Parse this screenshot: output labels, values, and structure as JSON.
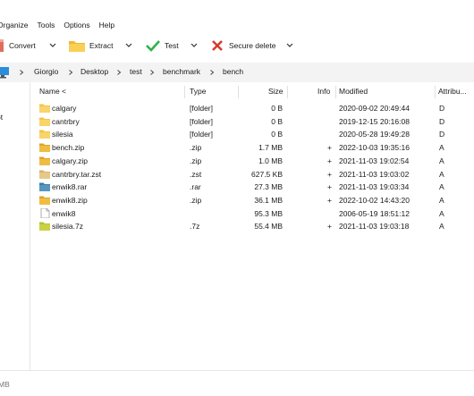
{
  "menu": [
    "Organize",
    "Tools",
    "Options",
    "Help"
  ],
  "toolbar": {
    "convert": "Convert",
    "extract": "Extract",
    "test": "Test",
    "secure_delete": "Secure delete"
  },
  "breadcrumb": [
    "Giorgio",
    "Desktop",
    "test",
    "benchmark",
    "bench"
  ],
  "nav": {
    "partial_label": "pt"
  },
  "columns": {
    "name": "Name <",
    "type": "Type",
    "size": "Size",
    "info": "Info",
    "modified": "Modified",
    "attributes": "Attribu..."
  },
  "files": [
    {
      "name": "calgary",
      "type": "[folder]",
      "size": "0 B",
      "info": "",
      "modified": "2020-09-02 20:49:44",
      "attr": "D",
      "icon": "folder-icon"
    },
    {
      "name": "cantrbry",
      "type": "[folder]",
      "size": "0 B",
      "info": "",
      "modified": "2019-12-15 20:16:08",
      "attr": "D",
      "icon": "folder-icon"
    },
    {
      "name": "silesia",
      "type": "[folder]",
      "size": "0 B",
      "info": "",
      "modified": "2020-05-28 19:49:28",
      "attr": "D",
      "icon": "folder-icon"
    },
    {
      "name": "bench.zip",
      "type": ".zip",
      "size": "1.7 MB",
      "info": "+",
      "modified": "2022-10-03 19:35:16",
      "attr": "A",
      "icon": "zip-archive-icon"
    },
    {
      "name": "calgary.zip",
      "type": ".zip",
      "size": "1.0 MB",
      "info": "+",
      "modified": "2021-11-03 19:02:54",
      "attr": "A",
      "icon": "zip-archive-icon"
    },
    {
      "name": "cantrbry.tar.zst",
      "type": ".zst",
      "size": "627.5 KB",
      "info": "+",
      "modified": "2021-11-03 19:03:02",
      "attr": "A",
      "icon": "zst-archive-icon"
    },
    {
      "name": "enwik8.rar",
      "type": ".rar",
      "size": "27.3 MB",
      "info": "+",
      "modified": "2021-11-03 19:03:34",
      "attr": "A",
      "icon": "rar-archive-icon"
    },
    {
      "name": "enwik8.zip",
      "type": ".zip",
      "size": "36.1 MB",
      "info": "+",
      "modified": "2022-10-02 14:43:20",
      "attr": "A",
      "icon": "zip-archive-icon"
    },
    {
      "name": "enwik8",
      "type": "",
      "size": "95.3 MB",
      "info": "",
      "modified": "2006-05-19 18:51:12",
      "attr": "A",
      "icon": "file-icon"
    },
    {
      "name": "silesia.7z",
      "type": ".7z",
      "size": "55.4 MB",
      "info": "+",
      "modified": "2021-11-03 19:03:18",
      "attr": "A",
      "icon": "7z-archive-icon"
    }
  ],
  "status": {
    "partial_text": "MB"
  },
  "colors": {
    "folder": "#f6c443",
    "zip": "#e0a425",
    "zst": "#d7b56d",
    "rar": "#3d7fa8",
    "sevenz": "#b7c234",
    "convert_red": "#e06c5d",
    "test_green": "#2fb14a",
    "delete_red": "#d63b2f"
  }
}
